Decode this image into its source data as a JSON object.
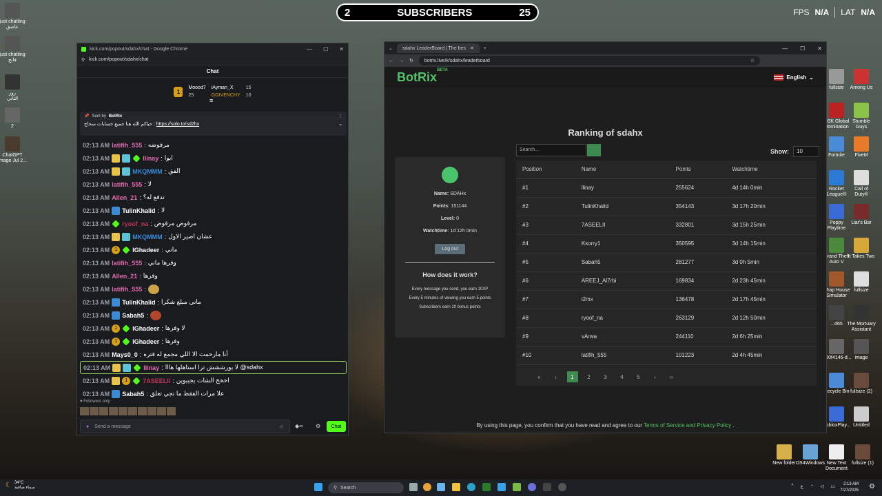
{
  "overlay": {
    "sub_count": "2",
    "sub_label": "SUBSCRIBERS",
    "sub_goal": "25",
    "fps_label": "FPS",
    "fps_value": "N/A",
    "lat_label": "LAT",
    "lat_value": "N/A"
  },
  "desktop_left": [
    {
      "label": "just chatting\nعاشق"
    },
    {
      "label": "just chatting\nفاتح"
    },
    {
      "label": "روز\nالتاني"
    },
    {
      "label": "2"
    },
    {
      "label": "ChatGPT\nImage Jul 2..."
    }
  ],
  "desktop_right": [
    {
      "label": "fullsize"
    },
    {
      "label": "Among Us"
    },
    {
      "label": "DSK Global\nDomination"
    },
    {
      "label": "Stumble\nGuys"
    },
    {
      "label": "Fortnite"
    },
    {
      "label": "FiveM"
    },
    {
      "label": "Rocket\nLeague®"
    },
    {
      "label": "Call of\nDuty®"
    },
    {
      "label": "Poppy\nPlaytime"
    },
    {
      "label": "Liar's Bar"
    },
    {
      "label": "Grand Theft\nAuto V"
    },
    {
      "label": "It Takes Two"
    },
    {
      "label": "Wrap House\nSimulator"
    },
    {
      "label": "fullsize"
    },
    {
      "label": "...d65"
    },
    {
      "label": "The Mortuary\nAssistant"
    },
    {
      "label": "...00f4146-d..."
    },
    {
      "label": "image"
    },
    {
      "label": "Recycle Bin"
    },
    {
      "label": "fullsize (2)"
    },
    {
      "label": "RobloxPlay..."
    },
    {
      "label": "Untitled"
    }
  ],
  "desktop_bottom": [
    {
      "label": "New folder"
    },
    {
      "label": "DS4Windows"
    },
    {
      "label": "New Text\nDocument"
    },
    {
      "label": "fullsize (1)"
    }
  ],
  "chat": {
    "title": "kick.com/popout/sdahx/chat - Google Chrome",
    "url": "kick.com/popout/sdahx/chat",
    "header": "Chat",
    "top_gifter": {
      "name": "Moood7",
      "count": "25"
    },
    "gifters": [
      {
        "name": "iAyman_X",
        "count": "15"
      },
      {
        "name": "GGIVENCHY",
        "count": "10"
      }
    ],
    "pinned": {
      "sent_by": "Sent by",
      "bot": "BotRix",
      "text": "حياكم الله هنا جميع حسابات سحاج",
      "link": "https://solo.to/sd2hx",
      "sep": ":"
    },
    "messages": [
      {
        "time": "02:13 AM",
        "user": "latifih_555",
        "color": "#e06bb0",
        "badges": [],
        "text": "مرفوضه"
      },
      {
        "time": "02:13 AM",
        "user": "llinay",
        "color": "#e06bb0",
        "badges": [
          "crown",
          "gift",
          "green"
        ],
        "text": "ابوا"
      },
      {
        "time": "02:13 AM",
        "user": "MKQMMM",
        "color": "#3a8ad6",
        "badges": [
          "crown",
          "gift"
        ],
        "text": "الفق"
      },
      {
        "time": "02:13 AM",
        "user": "latifih_555",
        "color": "#e06bb0",
        "badges": [],
        "text": "لا"
      },
      {
        "time": "02:13 AM",
        "user": "Allen_21",
        "color": "#e06bb0",
        "badges": [],
        "text": "تدفع له؟"
      },
      {
        "time": "02:13 AM",
        "user": "TulinKhalid",
        "color": "#ffffff",
        "badges": [
          "blue"
        ],
        "text": "لا"
      },
      {
        "time": "02:13 AM",
        "user": "ryoof_na",
        "color": "#c0365a",
        "badges": [
          "green"
        ],
        "text": "مرفوض مرفوض"
      },
      {
        "time": "02:13 AM",
        "user": "MKQMMM",
        "color": "#3a8ad6",
        "badges": [
          "crown",
          "gift"
        ],
        "text": "عشان اصير الاول"
      },
      {
        "time": "02:13 AM",
        "user": "IGhadeer",
        "color": "#ffffff",
        "badges": [
          "one",
          "green"
        ],
        "text": "ماني"
      },
      {
        "time": "02:13 AM",
        "user": "latifih_555",
        "color": "#e06bb0",
        "badges": [],
        "text": "وفرها ماني"
      },
      {
        "time": "02:13 AM",
        "user": "Allen_21",
        "color": "#e06bb0",
        "badges": [],
        "text": "وفرها"
      },
      {
        "time": "02:13 AM",
        "user": "latifih_555",
        "color": "#e06bb0",
        "badges": [],
        "text": "",
        "emote": "#c9a24a"
      },
      {
        "time": "02:13 AM",
        "user": "TulinKhalid",
        "color": "#ffffff",
        "badges": [
          "blue"
        ],
        "text": "ماني مبلغ شكرا"
      },
      {
        "time": "02:13 AM",
        "user": "Sabah5",
        "color": "#ffffff",
        "badges": [
          "blue"
        ],
        "text": "",
        "emote": "#b2452e"
      },
      {
        "time": "02:13 AM",
        "user": "IGhadeer",
        "color": "#ffffff",
        "badges": [
          "one",
          "green"
        ],
        "text": "لا وفرها"
      },
      {
        "time": "02:13 AM",
        "user": "IGhadeer",
        "color": "#ffffff",
        "badges": [
          "one",
          "green"
        ],
        "text": "وفرها"
      },
      {
        "time": "02:13 AM",
        "user": "Mays0_0",
        "color": "#ffffff",
        "badges": [],
        "text": "أنا مارحمت الا اللي مجمع له فتره"
      },
      {
        "time": "02:13 AM",
        "user": "llinay",
        "color": "#e06bb0",
        "badges": [
          "crown",
          "gift",
          "green"
        ],
        "text": "لا يورششش ترا استاهلها هااا @sdahx",
        "hl": true
      },
      {
        "time": "02:13 AM",
        "user": "7ASEELII",
        "color": "#c0365a",
        "badges": [
          "crown",
          "one",
          "green"
        ],
        "text": "اخخخ الشات يجيبوين"
      },
      {
        "time": "02:13 AM",
        "user": "Sabah5",
        "color": "#ffffff",
        "badges": [
          "blue"
        ],
        "text": "علا مرات الفقط ما تجي تعلق"
      }
    ],
    "followers_only": "Followers only",
    "send_placeholder": "Send a message",
    "chat_button": "Chat"
  },
  "botrix": {
    "tab_title": "sdahx LeaderBoard | The best",
    "url": "botrix.live/k/sdahx/leaderboard",
    "logo": "BotRix",
    "logo_sup": "BETA",
    "lang": "English",
    "heading": "Ranking of sdahx",
    "search_placeholder": "Search...",
    "show_label": "Show:",
    "show_value": "10",
    "profile": {
      "name_label": "Name:",
      "name": "SDAHx",
      "points_label": "Points:",
      "points": "151144",
      "level_label": "Level:",
      "level": "0",
      "watch_label": "Watchtime:",
      "watch": "1d 12h 0min",
      "logout": "Log out"
    },
    "how": {
      "title": "How does it work?",
      "lines": [
        "Every message you send, you earn 10XP",
        "Every 5 minutes of viewing you earn 5 points",
        "Subscribers earn 10 bonus points"
      ]
    },
    "columns": [
      "Position",
      "Name",
      "Points",
      "Watchtime"
    ],
    "rows": [
      [
        "#1",
        "llinay",
        "255624",
        "4d 14h 0min"
      ],
      [
        "#2",
        "TulinKhalid",
        "354143",
        "3d 17h 20min"
      ],
      [
        "#3",
        "7ASEELII",
        "332801",
        "3d 15h 25min"
      ],
      [
        "#4",
        "Ksorry1",
        "350595",
        "3d 14h 15min"
      ],
      [
        "#5",
        "Sabah5",
        "281277",
        "3d 0h 5min"
      ],
      [
        "#6",
        "AREEJ_Al7rbi",
        "169834",
        "2d 23h 45min"
      ],
      [
        "#7",
        "i2mx",
        "136478",
        "2d 17h 45min"
      ],
      [
        "#8",
        "ryoof_na",
        "263129",
        "2d 12h 50min"
      ],
      [
        "#9",
        "vArwa",
        "244110",
        "2d 6h 25min"
      ],
      [
        "#10",
        "latifih_555",
        "101223",
        "2d 4h 45min"
      ]
    ],
    "pages": [
      "1",
      "2",
      "3",
      "4",
      "5"
    ],
    "footer_pre": "By using this page, you confirm that you have read and agree to our",
    "footer_link": "Terms of Service and Privacy Policy",
    "footer_post": "."
  },
  "taskbar": {
    "temp": "34°C",
    "weather": "سماء صافية",
    "search": "Search",
    "time": "2:13 AM",
    "date": "7/27/2025",
    "lang": "ع"
  }
}
